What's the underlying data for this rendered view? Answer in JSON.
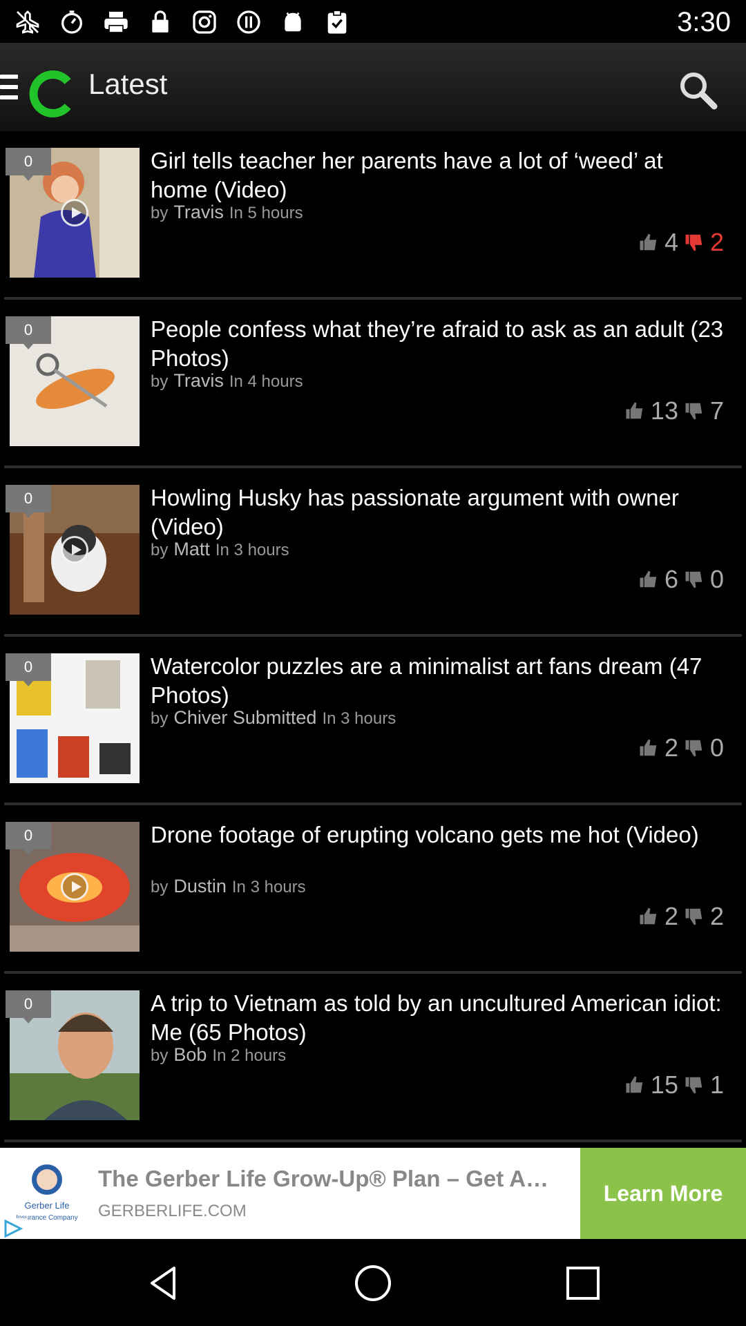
{
  "status_bar": {
    "time": "3:30",
    "icons": [
      "airplane-off-icon",
      "timer-icon",
      "print-icon",
      "lock-icon",
      "instagram-icon",
      "unknown-icon",
      "android-icon",
      "clipboard-icon"
    ]
  },
  "app_bar": {
    "title": "Latest",
    "logo_color": "#22c32a"
  },
  "articles": [
    {
      "comments": "0",
      "title": "Girl tells teacher her parents have a lot of ‘weed’ at home (Video)",
      "by": "by",
      "author": "Travis",
      "time": "In 5 hours",
      "up": "4",
      "down": "2",
      "down_active": true,
      "video": true,
      "thumb": "girl"
    },
    {
      "comments": "0",
      "title": "People confess what they’re afraid to ask as an adult (23 Photos)",
      "by": "by",
      "author": "Travis",
      "time": "In 4 hours",
      "up": "13",
      "down": "7",
      "down_active": false,
      "video": false,
      "thumb": "scissors"
    },
    {
      "comments": "0",
      "title": "Howling Husky has passionate argument with owner (Video)",
      "by": "by",
      "author": "Matt",
      "time": "In 3 hours",
      "up": "6",
      "down": "0",
      "down_active": false,
      "video": true,
      "thumb": "husky"
    },
    {
      "comments": "0",
      "title": "Watercolor puzzles are a minimalist art fans dream (47 Photos)",
      "by": "by",
      "author": "Chiver Submitted",
      "time": "In 3 hours",
      "up": "2",
      "down": "0",
      "down_active": false,
      "video": false,
      "thumb": "puzzle"
    },
    {
      "comments": "0",
      "title": "Drone footage of erupting volcano gets me hot (Video)",
      "by": "by",
      "author": "Dustin",
      "time": "In 3 hours",
      "up": "2",
      "down": "2",
      "down_active": false,
      "video": true,
      "thumb": "volcano"
    },
    {
      "comments": "0",
      "title": "A trip to Vietnam as told by an uncultured American idiot: Me (65 Photos)",
      "by": "by",
      "author": "Bob",
      "time": "In 2 hours",
      "up": "15",
      "down": "1",
      "down_active": false,
      "video": false,
      "thumb": "man"
    }
  ],
  "ad": {
    "logo_text": [
      "Gerber Life",
      "Insurance Company"
    ],
    "title": "The Gerber Life Grow-Up® Plan – Get A…",
    "domain": "GERBERLIFE.COM",
    "cta": "Learn More",
    "cta_color": "#8bc34a"
  },
  "nav": {
    "buttons": [
      "back-icon",
      "home-icon",
      "recents-icon"
    ]
  }
}
